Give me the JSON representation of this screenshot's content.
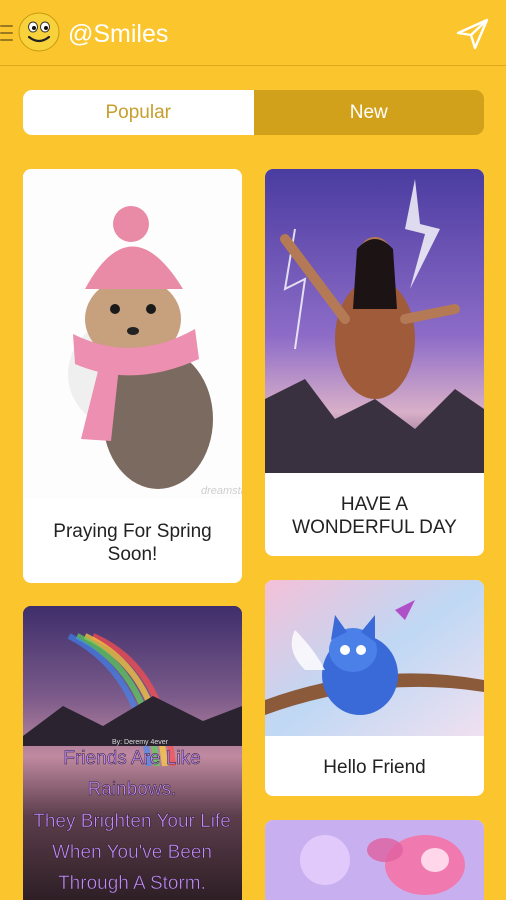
{
  "app": {
    "title": "@Smiles"
  },
  "tabs": [
    {
      "label": "Popular",
      "selected": true
    },
    {
      "label": "New",
      "selected": false
    }
  ],
  "cards": [
    {
      "caption": "Praying For Spring Soon!",
      "image": "puppy-in-pink-knit-hat-and-scarf",
      "watermark": "dreamstime.com"
    },
    {
      "caption": "HAVE A WONDERFUL DAY",
      "image": "native-woman-raising-hands-lightning-purple-sky"
    },
    {
      "caption": "",
      "image": "rainbow-over-lake",
      "credit": "By: Deremy 4ever",
      "overlay_text": [
        "Friends Are Like",
        "Rainbows.",
        "They Brighten Your Life",
        "When You've Been",
        "Through A Storm."
      ]
    },
    {
      "caption": "Hello Friend",
      "image": "blue-winged-kitten-on-branch-with-butterfly"
    },
    {
      "caption": "",
      "image": "pink-flowers"
    }
  ],
  "icons": {
    "menu": "menu-icon",
    "logo": "smiley-face-icon",
    "send": "send-icon"
  },
  "colors": {
    "background": "#fbc52d",
    "tab_active_bg": "#ffffff",
    "tab_inactive_bg": "#d2a11c",
    "tab_active_text": "#c79f2c"
  }
}
